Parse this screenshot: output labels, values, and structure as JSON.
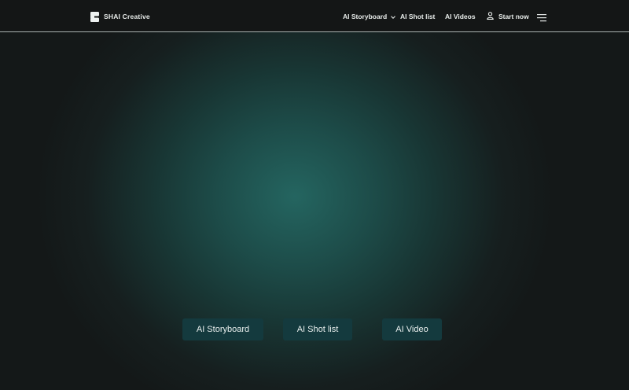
{
  "header": {
    "brand": "SHAI Creative",
    "nav": {
      "storyboard": "AI Storyboard",
      "shot_list": "AI Shot list",
      "videos": "AI Videos",
      "start": "Start now"
    },
    "icons": {
      "logo": "shai-logo-icon",
      "dropdown": "chevron-down-icon",
      "user": "user-icon",
      "menu": "hamburger-menu-icon"
    }
  },
  "hero": {
    "buttons": {
      "storyboard": "AI Storyboard",
      "shot_list": "AI Shot list",
      "video": "AI Video"
    }
  },
  "colors": {
    "background": "#151818",
    "glow": "#246560",
    "button_bg": "#143a3e",
    "text": "#e8ecea"
  }
}
